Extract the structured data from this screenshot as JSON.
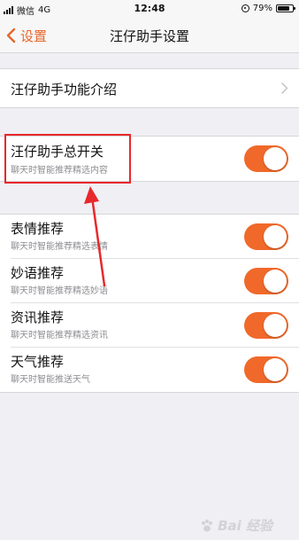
{
  "status_bar": {
    "carrier": "微信",
    "network": "4G",
    "time": "12:48",
    "battery": "79%",
    "battery_level": 0.79
  },
  "nav": {
    "back_label": "设置",
    "title": "汪仔助手设置"
  },
  "intro_row": {
    "title": "汪仔助手功能介绍"
  },
  "master_switch": {
    "title": "汪仔助手总开关",
    "subtitle": "聊天时智能推荐精选内容",
    "enabled": true
  },
  "recommend_items": [
    {
      "title": "表情推荐",
      "subtitle": "聊天时智能推荐精选表情",
      "enabled": true
    },
    {
      "title": "妙语推荐",
      "subtitle": "聊天时智能推荐精选妙语",
      "enabled": true
    },
    {
      "title": "资讯推荐",
      "subtitle": "聊天时智能推荐精选资讯",
      "enabled": true
    },
    {
      "title": "天气推荐",
      "subtitle": "聊天时智能推送天气",
      "enabled": true
    }
  ],
  "watermark": "Bai 经验",
  "colors": {
    "accent": "#e8662a",
    "toggle_on": "#f0692a",
    "annotation": "#e8282b",
    "background": "#efeff4"
  }
}
